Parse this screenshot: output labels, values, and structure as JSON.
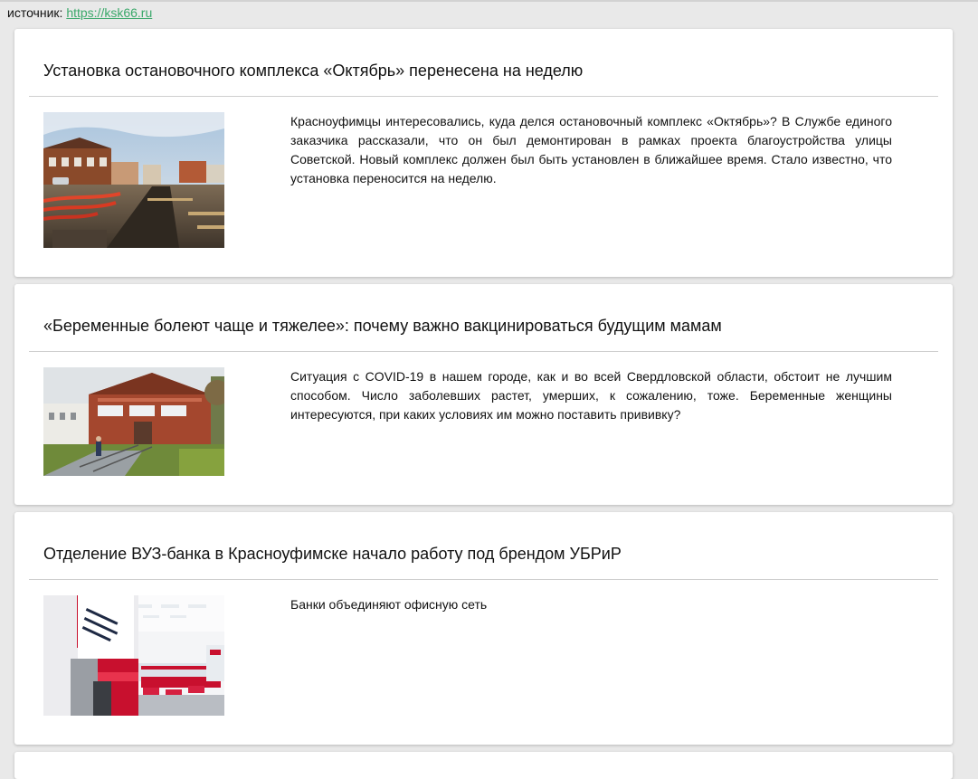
{
  "source": {
    "label": "источник:",
    "link_text": "https://ksk66.ru",
    "link_color": "#3aa86a"
  },
  "articles": [
    {
      "title": "Установка остановочного комплекса «Октябрь» перенесена на неделю",
      "excerpt": "Красноуфимцы интересовались, куда делся остановочный комплекс «Октябрь»? В Службе единого заказчика рассказали, что он был демонтирован в рамках проекта благоустройства улицы Советской. Новый комплекс должен был быть установлен в ближайшее время. Стало известно, что установка переносится на неделю.",
      "image": "street-construction-photo"
    },
    {
      "title": "«Беременные болеют чаще и тяжелее»: почему важно вакцинироваться будущим мамам",
      "excerpt": "Ситуация с COVID-19 в нашем городе, как и во всей Свердловской области, обстоит не лучшим способом. Число заболевших растет, умерших, к сожалению, тоже. Беременные женщины интересуются, при каких условиях им можно поставить прививку?",
      "image": "brick-building-photo"
    },
    {
      "title": "Отделение ВУЗ-банка в Красноуфимске начало работу под брендом УБРиР",
      "excerpt": "Банки объединяют офисную сеть",
      "image": "bank-office-photo"
    }
  ]
}
